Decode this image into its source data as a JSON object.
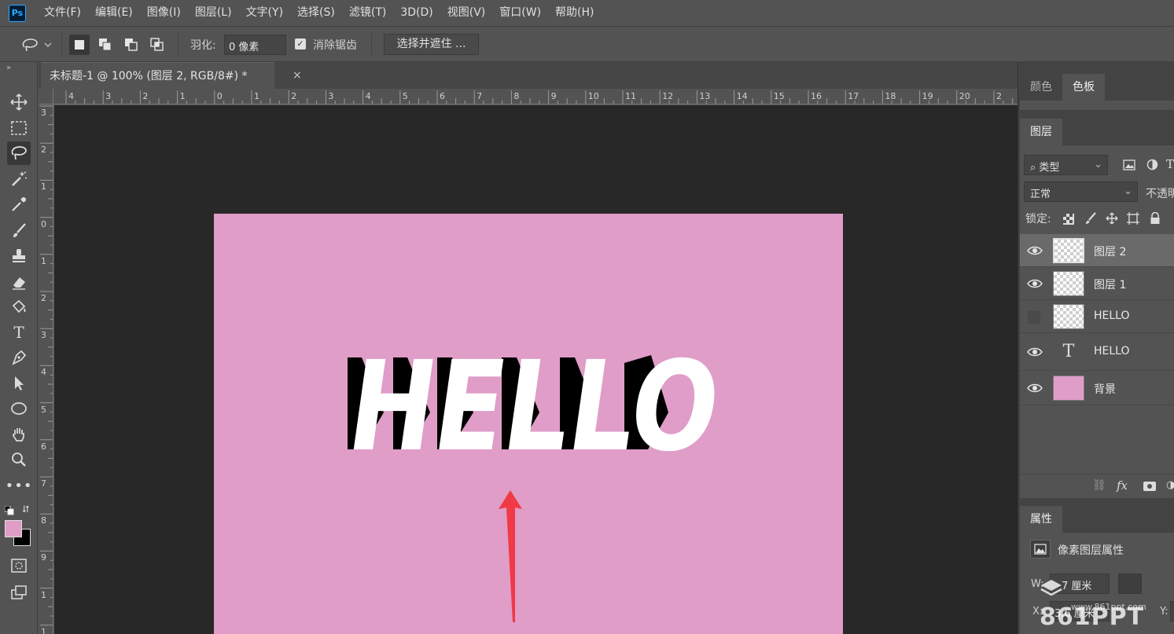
{
  "app": {
    "logo": "Ps",
    "menu": [
      "文件(F)",
      "编辑(E)",
      "图像(I)",
      "图层(L)",
      "文字(Y)",
      "选择(S)",
      "滤镜(T)",
      "3D(D)",
      "视图(V)",
      "窗口(W)",
      "帮助(H)"
    ]
  },
  "options": {
    "feather_label": "羽化:",
    "feather_value": "0 像素",
    "antialias_label": "消除锯齿",
    "antialias_checked": true,
    "select_mask_button": "选择并遮住 ..."
  },
  "document": {
    "tab_title": "未标题-1 @ 100% (图层 2, RGB/8#) *",
    "close_glyph": "×",
    "background_color": "#df9dc8",
    "artwork_text": "HELLO"
  },
  "rulers": {
    "top_labels": [
      "4",
      "3",
      "2",
      "1",
      "0",
      "1",
      "2",
      "3",
      "4",
      "5",
      "6",
      "7",
      "8",
      "9",
      "10",
      "11",
      "12",
      "13",
      "14",
      "15",
      "16",
      "17",
      "18",
      "19",
      "20",
      "2"
    ],
    "left_labels": [
      "3",
      "2",
      "1",
      "0",
      "1",
      "2",
      "3",
      "4",
      "5",
      "6",
      "7",
      "8",
      "9",
      "1",
      "1"
    ]
  },
  "tools": [
    "move-tool",
    "marquee-tool",
    "lasso-tool",
    "magic-wand-tool",
    "eyedropper-tool",
    "brush-tool",
    "stamp-tool",
    "eraser-tool",
    "paint-bucket-tool",
    "type-tool",
    "pen-tool",
    "path-selection-tool",
    "ellipse-tool",
    "hand-tool",
    "zoom-tool",
    "more-tools"
  ],
  "colors": {
    "foreground": "#df9dc8",
    "background": "#000000",
    "accent_arrow": "#f03a45"
  },
  "color_panel": {
    "tabs": [
      "颜色",
      "色板"
    ],
    "active_tab": "色板"
  },
  "layers_panel": {
    "tab": "图层",
    "filter_label": "类型",
    "blend_mode": "正常",
    "opacity_label": "不透明",
    "lock_label": "锁定:",
    "layers": [
      {
        "name": "图层 2",
        "visible": true,
        "selected": true,
        "thumb": "transparent"
      },
      {
        "name": "图层 1",
        "visible": true,
        "selected": false,
        "thumb": "transparent"
      },
      {
        "name": "HELLO",
        "visible": false,
        "selected": false,
        "thumb": "transparent"
      },
      {
        "name": "HELLO",
        "visible": true,
        "selected": false,
        "thumb": "text"
      },
      {
        "name": "背景",
        "visible": true,
        "selected": false,
        "thumb": "pink"
      }
    ]
  },
  "properties_panel": {
    "tab": "属性",
    "title": "像素图层属性",
    "w_label": "W:",
    "w_value": "7 厘米",
    "x_label": "X:",
    "x_value": "3.6 厘米",
    "y_label": "Y:"
  },
  "watermark": {
    "brand": "861PPT",
    "url": "www.861ppt.com"
  }
}
